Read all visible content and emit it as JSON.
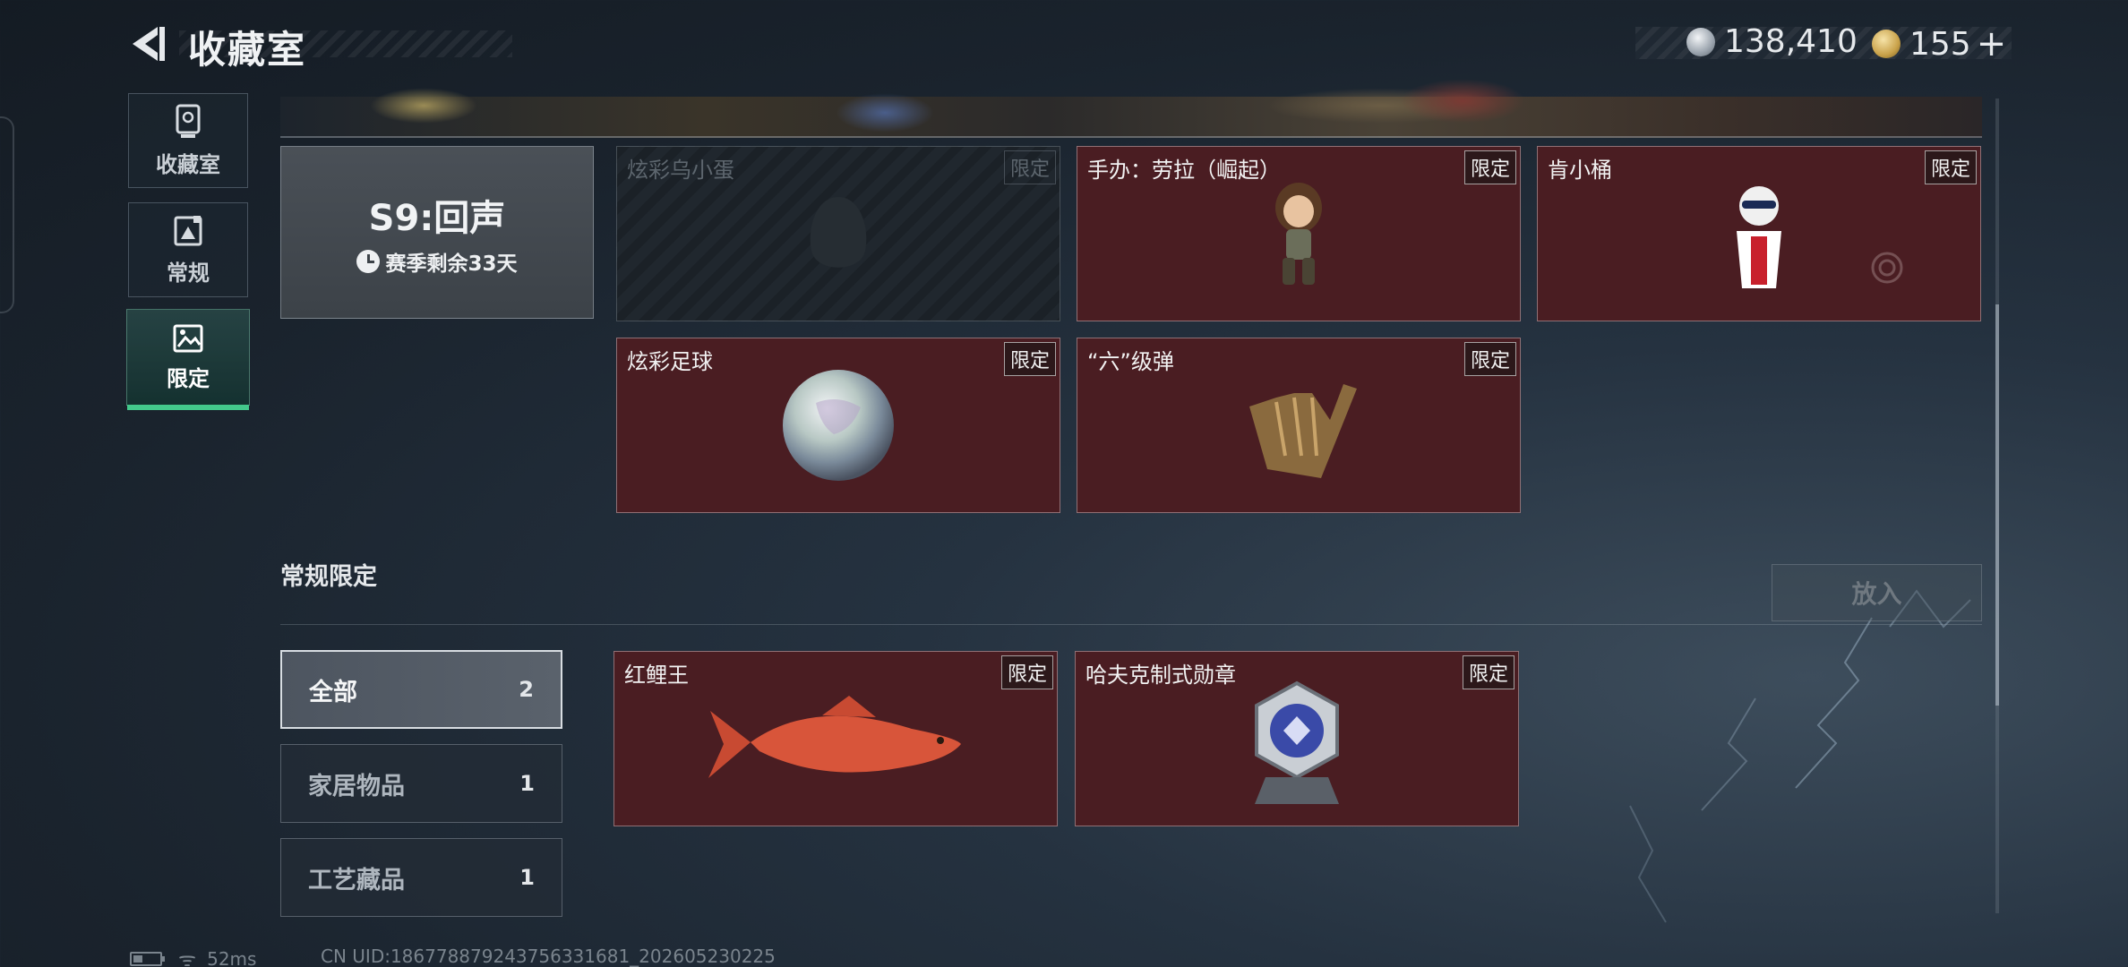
{
  "header": {
    "title": "收藏室",
    "currency_silver": "138,410",
    "currency_gold": "155",
    "plus": "+"
  },
  "sidebar": {
    "items": [
      {
        "label": "收藏室",
        "icon": "trophy-icon"
      },
      {
        "label": "常规",
        "icon": "gallery-icon"
      },
      {
        "label": "限定",
        "icon": "image-icon"
      }
    ],
    "active_index": 2
  },
  "season": {
    "title": "S9:回声",
    "remaining": "赛季剩余33天"
  },
  "season_items": [
    {
      "name": "炫彩乌小蛋",
      "badge": "限定",
      "locked": true
    },
    {
      "name": "手办：劳拉（崛起）",
      "badge": "限定",
      "locked": false
    },
    {
      "name": "肯小桶",
      "badge": "限定",
      "locked": false
    },
    {
      "name": "炫彩足球",
      "badge": "限定",
      "locked": false
    },
    {
      "name": "“六”级弹",
      "badge": "限定",
      "locked": false
    }
  ],
  "regular_section": {
    "title": "常规限定",
    "place_button": "放入",
    "filters": [
      {
        "label": "全部",
        "count": "2"
      },
      {
        "label": "家居物品",
        "count": "1"
      },
      {
        "label": "工艺藏品",
        "count": "1"
      }
    ],
    "items": [
      {
        "name": "红鲤王",
        "badge": "限定"
      },
      {
        "name": "哈夫克制式勋章",
        "badge": "限定"
      }
    ]
  },
  "status_bar": {
    "ping": "52ms",
    "uid": "CN UID:186778879243756331681_202605230225"
  },
  "colors": {
    "accent_green": "#43c98b",
    "item_card_bg": "#4a1d22",
    "background": "#1a232d"
  }
}
